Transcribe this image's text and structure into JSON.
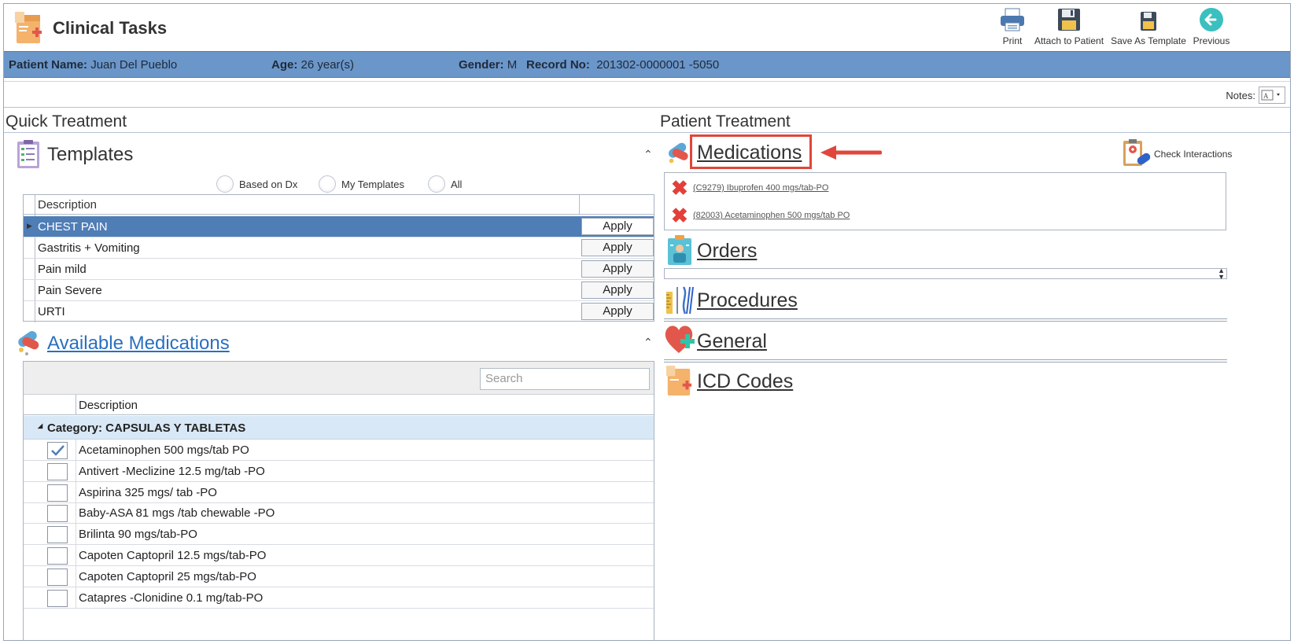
{
  "app": {
    "title": "Clinical Tasks"
  },
  "toolbar": {
    "print": "Print",
    "attach": "Attach to Patient",
    "save_template": "Save As Template",
    "previous": "Previous"
  },
  "patient": {
    "name_label": "Patient Name:",
    "name_value": "Juan Del Pueblo",
    "age_label": "Age:",
    "age_value": "26 year(s)",
    "gender_label": "Gender:",
    "gender_value": "M",
    "record_label": "Record No:",
    "record_value": "201302-0000001 -5050"
  },
  "notes": {
    "label": "Notes:"
  },
  "quick_treatment": {
    "title": "Quick Treatment",
    "templates": {
      "title": "Templates",
      "filters": [
        "Based on Dx",
        "My Templates",
        "All"
      ],
      "column": "Description",
      "apply_label": "Apply",
      "rows": [
        "CHEST PAIN",
        "Gastritis + Vomiting",
        "Pain mild",
        "Pain Severe",
        "URTI"
      ]
    },
    "available": {
      "title": "Available Medications",
      "search_placeholder": "Search",
      "column": "Description",
      "category": "Category: CAPSULAS Y TABLETAS",
      "items": [
        {
          "label": "Acetaminophen 500 mgs/tab PO",
          "checked": true
        },
        {
          "label": "Antivert -Meclizine 12.5 mg/tab -PO",
          "checked": false
        },
        {
          "label": "Aspirina 325 mgs/ tab -PO",
          "checked": false
        },
        {
          "label": "Baby-ASA 81 mgs /tab chewable -PO",
          "checked": false
        },
        {
          "label": "Brilinta 90 mgs/tab-PO",
          "checked": false
        },
        {
          "label": "Capoten Captopril 12.5 mgs/tab-PO",
          "checked": false
        },
        {
          "label": "Capoten Captopril 25 mgs/tab-PO",
          "checked": false
        },
        {
          "label": "Catapres -Clonidine 0.1 mg/tab-PO",
          "checked": false
        }
      ]
    }
  },
  "patient_treatment": {
    "title": "Patient Treatment",
    "check_interactions": "Check Interactions",
    "medications": {
      "title": "Medications",
      "items": [
        "(C9279) Ibuprofen 400 mgs/tab-PO",
        "(82003) Acetaminophen 500 mgs/tab  PO"
      ]
    },
    "orders": "Orders",
    "procedures": "Procedures",
    "general": "General",
    "icd": "ICD Codes"
  },
  "colors": {
    "patient_bar": "#6b96c9",
    "selected_row": "#4f7db6",
    "highlight": "#e0463a",
    "link": "#2a6fc0"
  }
}
